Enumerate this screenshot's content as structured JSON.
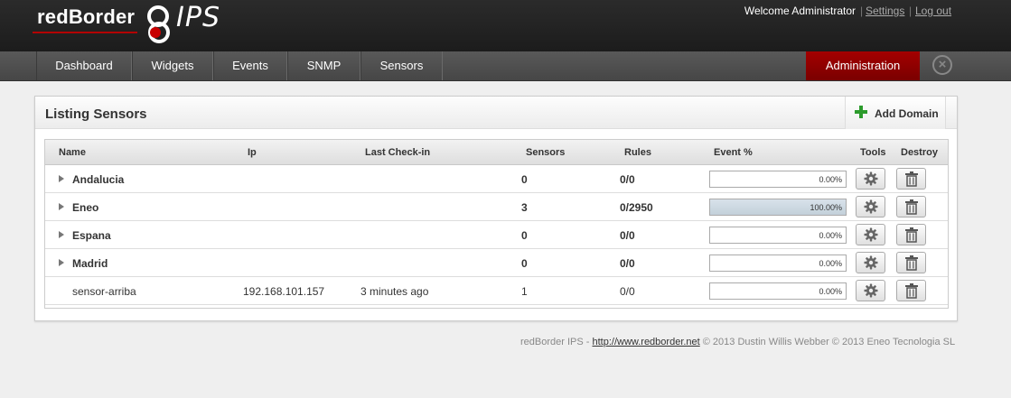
{
  "header": {
    "logo_text": "redBorder",
    "logo_product": "IPS",
    "welcome": "Welcome Administrator",
    "settings_label": "Settings",
    "logout_label": "Log out",
    "separator": "|"
  },
  "nav": {
    "items": [
      "Dashboard",
      "Widgets",
      "Events",
      "SNMP",
      "Sensors"
    ],
    "admin": "Administration",
    "close_icon": "×"
  },
  "panel": {
    "title": "Listing Sensors",
    "add_domain": "Add Domain"
  },
  "table": {
    "columns": [
      "Name",
      "Ip",
      "Last Check-in",
      "Sensors",
      "Rules",
      "Event %",
      "Tools",
      "Destroy"
    ],
    "rows": [
      {
        "name": "Andalucia",
        "ip": "",
        "checkin": "",
        "sensors": "0",
        "rules": "0/0",
        "event_pct": "0.00%",
        "event_fill": 0,
        "domain": true
      },
      {
        "name": "Eneo",
        "ip": "",
        "checkin": "",
        "sensors": "3",
        "rules": "0/2950",
        "event_pct": "100.00%",
        "event_fill": 100,
        "domain": true
      },
      {
        "name": "Espana",
        "ip": "",
        "checkin": "",
        "sensors": "0",
        "rules": "0/0",
        "event_pct": "0.00%",
        "event_fill": 0,
        "domain": true
      },
      {
        "name": "Madrid",
        "ip": "",
        "checkin": "",
        "sensors": "0",
        "rules": "0/0",
        "event_pct": "0.00%",
        "event_fill": 0,
        "domain": true
      },
      {
        "name": "sensor-arriba",
        "ip": "192.168.101.157",
        "checkin": "3 minutes ago",
        "sensors": "1",
        "rules": "0/0",
        "event_pct": "0.00%",
        "event_fill": 0,
        "domain": false
      }
    ]
  },
  "footer": {
    "prefix": "redBorder IPS - ",
    "link": "http://www.redborder.net",
    "suffix": " © 2013 Dustin Willis Webber © 2013 Eneo Tecnologia SL"
  },
  "colors": {
    "accent": "#a40000",
    "add_icon": "#2c9b2c"
  },
  "icons": [
    "redborder-logo-icon",
    "close-circle-icon",
    "plus-icon",
    "expand-caret-icon",
    "gear-icon",
    "trash-icon"
  ]
}
